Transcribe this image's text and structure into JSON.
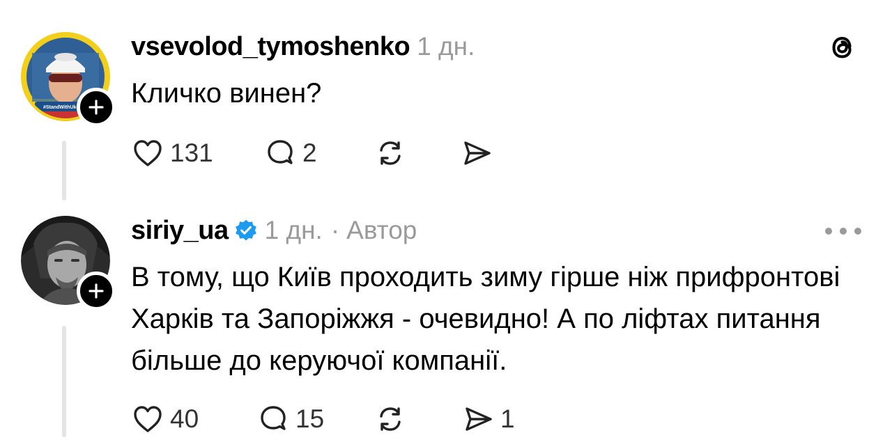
{
  "posts": [
    {
      "username": "vsevolod_tymoshenko",
      "time": "1 дн.",
      "verified": false,
      "author_tag": "",
      "avatar_badge_text": "#StandWithUkraine",
      "text": "Кличко винен?",
      "likes": "131",
      "replies": "2",
      "reposts": "",
      "shares": ""
    },
    {
      "username": "siriy_ua",
      "time": "1 дн.",
      "verified": true,
      "separator": "·",
      "author_tag": "Автор",
      "text": "В тому, що Київ проходить зиму гірше ніж прифронтові Харків та Запоріжжя - очевидно! А по ліфтах питання більше до керуючої компанії.",
      "likes": "40",
      "replies": "15",
      "reposts": "",
      "shares": "1"
    }
  ],
  "colors": {
    "text": "#000000",
    "secondary": "#9a9a9a",
    "verified_blue": "#1d9bf0",
    "thread_line": "#e4e4e4"
  },
  "icons": {
    "brand": "threads-logo-icon",
    "follow": "plus-icon",
    "like": "heart-icon",
    "reply": "comment-icon",
    "repost": "repost-icon",
    "share": "send-icon",
    "more": "more-dots-icon",
    "verified": "verified-badge-icon"
  }
}
